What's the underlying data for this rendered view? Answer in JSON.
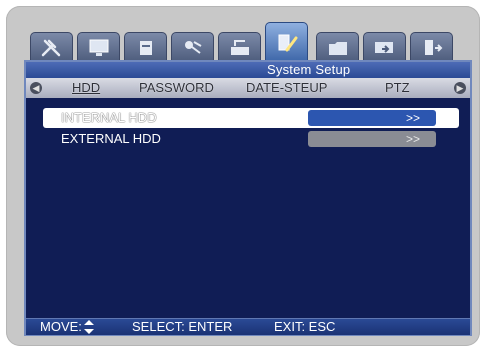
{
  "icon_tabs": [
    {
      "name": "tools-icon",
      "active": false
    },
    {
      "name": "monitor-icon",
      "active": false
    },
    {
      "name": "dvr-icon",
      "active": false
    },
    {
      "name": "camera-icon",
      "active": false
    },
    {
      "name": "record-icon",
      "active": false
    },
    {
      "name": "system-setup-icon",
      "active": true
    },
    {
      "name": "folder-icon",
      "active": false
    },
    {
      "name": "network-icon",
      "active": false
    },
    {
      "name": "exit-door-icon",
      "active": false
    }
  ],
  "header": {
    "title": "System Setup"
  },
  "subtabs": [
    {
      "label": "HDD",
      "active": true
    },
    {
      "label": "PASSWORD",
      "active": false
    },
    {
      "label": "DATE-STEUP",
      "active": false
    },
    {
      "label": "PTZ",
      "active": false
    }
  ],
  "rows": [
    {
      "label": "INTERNAL HDD",
      "button": ">>",
      "selected": true
    },
    {
      "label": "EXTERNAL HDD",
      "button": ">>",
      "selected": false
    }
  ],
  "status": {
    "move": "MOVE:",
    "select": "SELECT: ENTER",
    "exit": "EXIT: ESC"
  },
  "colors": {
    "screen_bg": "#101d55",
    "title_bar": "#2b4a95",
    "selected_button": "#2c56b0",
    "unselected_button": "#8a8c94"
  }
}
